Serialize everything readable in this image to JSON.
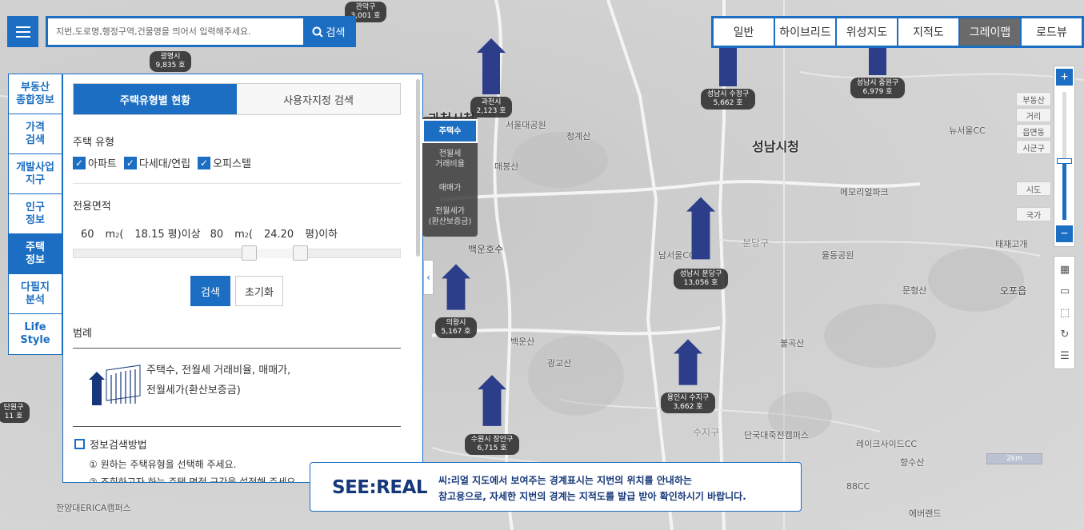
{
  "search": {
    "placeholder": "지번,도로명,행정구역,건물명을 띄어서 입력해주세요.",
    "button_label": "검색"
  },
  "map_types": [
    {
      "label": "일반",
      "active": false
    },
    {
      "label": "하이브리드",
      "active": false
    },
    {
      "label": "위성지도",
      "active": false
    },
    {
      "label": "지적도",
      "active": false
    },
    {
      "label": "그레이맵",
      "active": true
    },
    {
      "label": "로드뷰",
      "active": false
    }
  ],
  "left_nav": [
    {
      "label": "부동산\n종합정보",
      "active": false
    },
    {
      "label": "가격\n검색",
      "active": false
    },
    {
      "label": "개발사업\n지구",
      "active": false
    },
    {
      "label": "인구\n정보",
      "active": false
    },
    {
      "label": "주택\n정보",
      "active": true
    },
    {
      "label": "다필지\n분석",
      "active": false
    },
    {
      "label": "Life\nStyle",
      "active": false
    }
  ],
  "panel": {
    "tabs": [
      {
        "label": "주택유형별 현황",
        "active": true
      },
      {
        "label": "사용자지정 검색",
        "active": false
      }
    ],
    "housing_type_label": "주택 유형",
    "housing_types": [
      "아파트",
      "다세대/연립",
      "오피스텔"
    ],
    "area_label": "전용면적",
    "area": {
      "min_m2": "60",
      "m2_unit": "m",
      "min_pyeong": "18.15",
      "min_suffix": "평)이상",
      "max_m2": "80",
      "max_pyeong": "24.20",
      "max_suffix": "평)이하",
      "open_paren": "(",
      "superscript": "2"
    },
    "search_button": "검색",
    "reset_button": "초기화",
    "legend_label": "범례",
    "legend_text_1": "주택수, 전월세 거래비율, 매매가,",
    "legend_text_2": "전월세가(환산보증금)",
    "info_title": "정보검색방법",
    "info_steps": [
      {
        "num": "①",
        "text": "원하는 주택유형을 선택해 주세요."
      },
      {
        "num": "②",
        "text": "조회하고자 하는 주택 면적 구간을 설정해 주세요."
      }
    ]
  },
  "layer_menu": [
    {
      "label": "주택수",
      "active": true
    },
    {
      "label": "전월세\n거래비율",
      "active": false
    },
    {
      "label": "매매가",
      "active": false
    },
    {
      "label": "전월세가\n(환산보증금)",
      "active": false
    }
  ],
  "zoom": {
    "plus": "+",
    "minus": "−",
    "levels": [
      "부동산",
      "거리",
      "읍면동",
      "시군구",
      "시도",
      "국가"
    ]
  },
  "notice": {
    "logo": "SEE:REAL",
    "text": "씨:리얼 지도에서 보여주는 경계표시는 지번의 위치를 안내하는\n참고용으로, 자세한 지번의 경계는 지적도를 발급 받아 확인하시기 바랍니다."
  },
  "scale_label": "2km",
  "markers": [
    {
      "name": "과천시",
      "count": "2,123 호"
    },
    {
      "name": "성남시 수정구",
      "count": "5,662 호"
    },
    {
      "name": "성남시 중원구",
      "count": "6,979 호"
    },
    {
      "name": "성남시 분당구",
      "count": "13,056 호"
    },
    {
      "name": "의왕시",
      "count": "5,167 호"
    },
    {
      "name": "용인시 수지구",
      "count": "3,662 호"
    },
    {
      "name": "수원시 장안구",
      "count": "6,715 호"
    },
    {
      "name": "광명시",
      "count": "9,835 호"
    },
    {
      "name": "관악구",
      "count": "3,001 호"
    },
    {
      "name": "단원구",
      "count": "11 호"
    }
  ],
  "places": [
    "과천시청",
    "성남시청",
    "서울대공원",
    "청계산",
    "매봉산",
    "백운호수",
    "백운산",
    "광교산",
    "남서울CC",
    "메모리얼파크",
    "분당구",
    "율동공원",
    "문형산",
    "불곡산",
    "수지구",
    "단국대죽전캠퍼스",
    "레이크사이드CC",
    "향수산",
    "한양대ERICA캠퍼스",
    "88CC",
    "에버랜드",
    "오포읍",
    "뉴서울CC",
    "태재고개"
  ],
  "colors": {
    "accent": "#1b6ec2",
    "marker": "#2c3e8a",
    "logo": "#16387a"
  }
}
